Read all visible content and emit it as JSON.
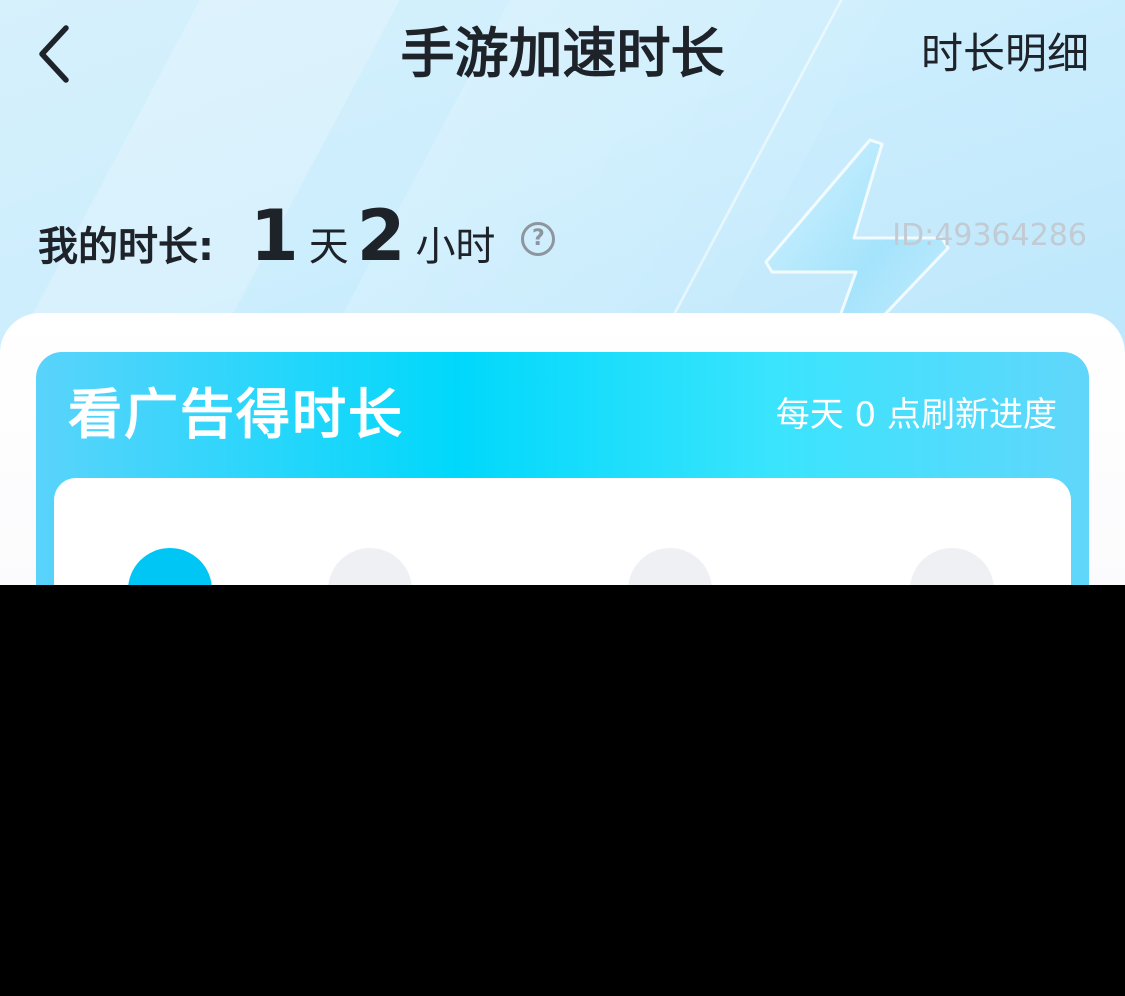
{
  "nav": {
    "title": "手游加速时长",
    "detail_link": "时长明细"
  },
  "duration": {
    "label": "我的时长:",
    "days_value": "1",
    "days_unit": "天",
    "hours_value": "2",
    "hours_unit": "小时"
  },
  "user_id": "ID:49364286",
  "ad_card": {
    "title": "看广告得时长",
    "refresh_note": "每天 0 点刷新进度"
  },
  "colors": {
    "accent": "#00d8fb",
    "active_step": "#00c6f5",
    "text": "#1e2229"
  },
  "icons": {
    "back": "chevron-left-icon",
    "help": "question-circle-icon",
    "bolt": "lightning-bolt-icon"
  }
}
